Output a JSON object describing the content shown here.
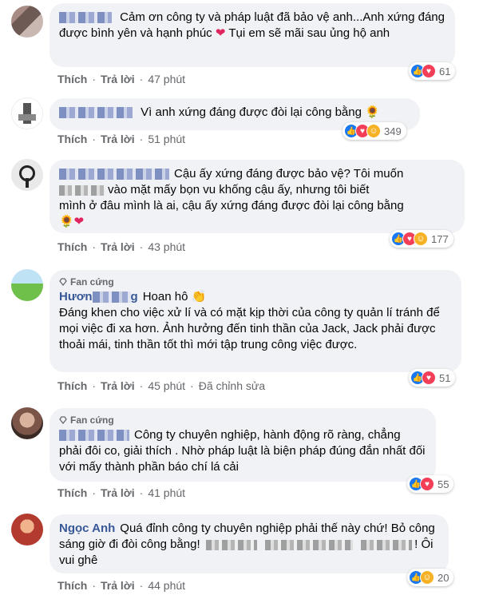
{
  "comments": [
    {
      "name": "",
      "text": "Cảm ơn công ty và pháp luật đã bảo vệ anh...Anh xứng đáng được bình yên và hạnh phúc",
      "text_tail": "Tụi em sẽ mãi sau ủng hộ anh",
      "emoji": "❤",
      "like": "Thích",
      "reply": "Trả lời",
      "time": "47 phút",
      "reaction_count": "61",
      "reaction_icons": [
        "like-icon",
        "love-icon"
      ]
    },
    {
      "name": "",
      "text": "Vì anh xứng đáng được đòi lại công bằng",
      "emoji": "🌻",
      "like": "Thích",
      "reply": "Trả lời",
      "time": "51 phút",
      "reaction_count": "349",
      "reaction_icons": [
        "like-icon",
        "love-icon",
        "care-icon"
      ]
    },
    {
      "name": "",
      "text1": "Cậu ấy xứng đáng được bảo vệ? Tôi muốn",
      "text2": "vào mặt mấy bọn vu khống cậu ấy, nhưng tôi biết",
      "text3": "mình ở đâu mình là ai, cậu ấy xứng đáng được đòi lại công bằng",
      "emoji": "🌻❤",
      "like": "Thích",
      "reply": "Trả lời",
      "time": "43 phút",
      "reaction_count": "177",
      "reaction_icons": [
        "like-icon",
        "love-icon",
        "care-icon"
      ]
    },
    {
      "badge": "Fan cứng",
      "name": "Hươn",
      "name_tail": "g",
      "head_text": "Hoan hô",
      "head_emoji": "👏",
      "text": "Đáng khen cho việc xử lí và có mặt kịp thời của công ty quản lí tránh để mọi việc đi xa hơn. Ảnh hưởng đến tinh thần của Jack, Jack phải được thoải mái, tinh thần tốt thì mới tập trung công việc được.",
      "like": "Thích",
      "reply": "Trả lời",
      "time": "45 phút",
      "edited": "Đã chỉnh sửa",
      "reaction_count": "51",
      "reaction_icons": [
        "like-icon",
        "love-icon"
      ]
    },
    {
      "badge": "Fan cứng",
      "name": "",
      "text": "Công ty chuyên nghiệp, hành động rõ ràng, chẳng phải đôi co, giải thích . Nhờ pháp luật là biện pháp đúng đắn nhất đối với mấy thành phần báo chí lá cải",
      "like": "Thích",
      "reply": "Trả lời",
      "time": "41 phút",
      "reaction_count": "55",
      "reaction_icons": [
        "like-icon",
        "love-icon"
      ]
    },
    {
      "name": "Ngọc Anh",
      "text": "Quá đỉnh công ty chuyên nghiệp phải thế này chứ! Bỏ công sáng giờ đi đòi công bằng!",
      "text_tail": "! Ôi vui ghê",
      "like": "Thích",
      "reply": "Trả lời",
      "time": "44 phút",
      "reaction_count": "20",
      "reaction_icons": [
        "like-icon",
        "care-icon"
      ]
    }
  ],
  "colors": {
    "bubble": "#f0f2f5",
    "meta": "#65676b",
    "like": "#1877f2",
    "love": "#f33e58",
    "care": "#f7b125"
  }
}
